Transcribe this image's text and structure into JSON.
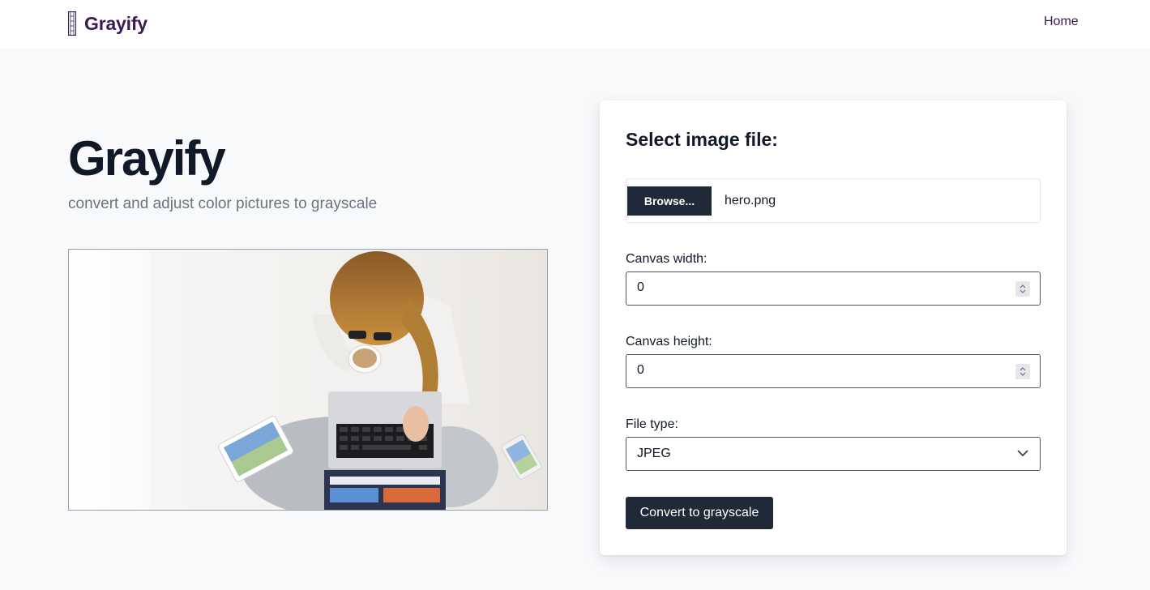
{
  "navbar": {
    "brand_name": "Grayify",
    "logo_icon": "film-strip-icon",
    "home_link": "Home",
    "brand_color": "#3a1a4f"
  },
  "hero": {
    "title": "Grayify",
    "subtitle": "convert and adjust color pictures to grayscale"
  },
  "form": {
    "title": "Select image file:",
    "browse_label": "Browse...",
    "file_name": "hero.png",
    "canvas_width_label": "Canvas width:",
    "canvas_width_value": "0",
    "canvas_height_label": "Canvas height:",
    "canvas_height_value": "0",
    "file_type_label": "File type:",
    "file_type_value": "JPEG",
    "convert_label": "Convert to grayscale"
  },
  "colors": {
    "dark_button": "#1f2937",
    "page_background": "#f8f9fb"
  }
}
